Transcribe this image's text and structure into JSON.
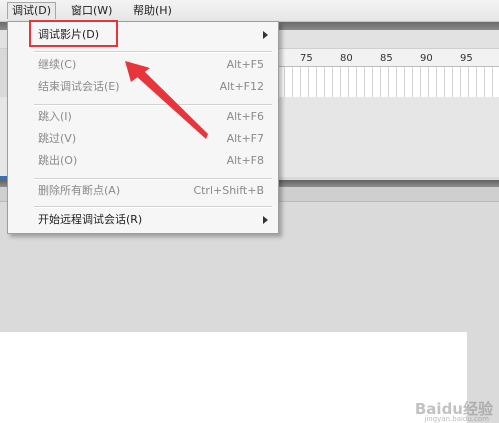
{
  "menubar": {
    "items": [
      {
        "label": "调试(D)"
      },
      {
        "label": "窗口(W)"
      },
      {
        "label": "帮助(H)"
      }
    ]
  },
  "timeline": {
    "ruler_ticks": [
      "75",
      "80",
      "85",
      "90",
      "95"
    ]
  },
  "debug_menu": {
    "items": [
      {
        "label": "调试影片(D)",
        "shortcut": "",
        "submenu": true,
        "enabled": true
      },
      {
        "label": "继续(C)",
        "shortcut": "Alt+F5",
        "submenu": false,
        "enabled": false
      },
      {
        "label": "结束调试会话(E)",
        "shortcut": "Alt+F12",
        "submenu": false,
        "enabled": false
      },
      {
        "label": "跳入(I)",
        "shortcut": "Alt+F6",
        "submenu": false,
        "enabled": false
      },
      {
        "label": "跳过(V)",
        "shortcut": "Alt+F7",
        "submenu": false,
        "enabled": false
      },
      {
        "label": "跳出(O)",
        "shortcut": "Alt+F8",
        "submenu": false,
        "enabled": false
      },
      {
        "label": "删除所有断点(A)",
        "shortcut": "Ctrl+Shift+B",
        "submenu": false,
        "enabled": false
      },
      {
        "label": "开始远程调试会话(R)",
        "shortcut": "",
        "submenu": true,
        "enabled": true
      }
    ]
  },
  "annotation": {
    "color": "#e8343b"
  },
  "watermark": {
    "text": "Baidu经验",
    "url": "jingyan.baidu.com"
  },
  "colors": {
    "menu_bg": "#f6f6f6",
    "disabled_text": "#8a8a8a",
    "accent_red": "#e8343b"
  }
}
